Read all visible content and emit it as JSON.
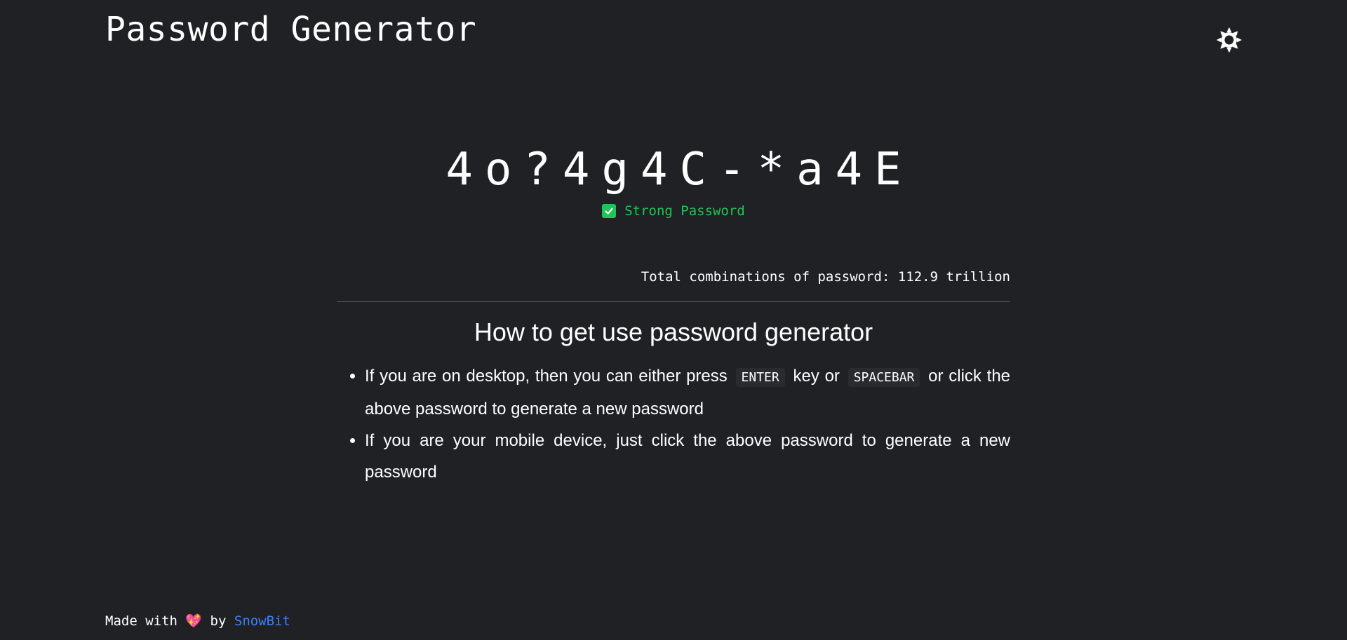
{
  "header": {
    "title": "Password Generator",
    "theme_icon": "sun-icon"
  },
  "generator": {
    "password": "4o?4g4C-*a4E",
    "strength_label": "Strong Password",
    "strength_icon": "check-square-icon",
    "combinations_text": "Total combinations of password: 112.9 trillion"
  },
  "howto": {
    "title": "How to get use password generator",
    "item1_before": "If you are on desktop, then you can either press",
    "item1_key1": "ENTER",
    "item1_middle": "key or",
    "item1_key2": "SPACEBAR",
    "item1_after": "or click the above password to generate a new password",
    "item2": "If you are your mobile device, just click the above password to generate a new password"
  },
  "footer": {
    "made_with": "Made with",
    "heart": "💖",
    "by": "by",
    "author_link": "SnowBit"
  },
  "colors": {
    "background": "#202124",
    "text": "#ffffff",
    "success": "#1fc558",
    "link": "#3b82f6",
    "divider": "#5f6063"
  }
}
